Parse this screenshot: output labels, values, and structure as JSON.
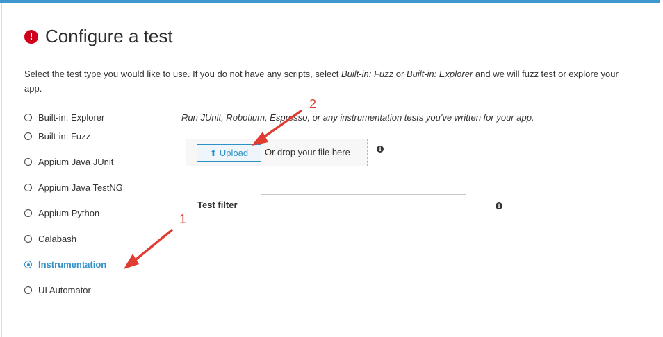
{
  "header": {
    "title": "Configure a test",
    "alert_icon_glyph": "!"
  },
  "description": {
    "prefix": "Select the test type you would like to use. If you do not have any scripts, select ",
    "builtin_fuzz": "Built-in: Fuzz",
    "middle": " or ",
    "builtin_explorer": "Built-in: Explorer",
    "suffix": " and we will fuzz test or explore your app."
  },
  "test_types": [
    {
      "label": "Built-in: Explorer",
      "selected": false
    },
    {
      "label": "Built-in: Fuzz",
      "selected": false
    },
    {
      "label": "Appium Java JUnit",
      "selected": false
    },
    {
      "label": "Appium Java TestNG",
      "selected": false
    },
    {
      "label": "Appium Python",
      "selected": false
    },
    {
      "label": "Calabash",
      "selected": false
    },
    {
      "label": "Instrumentation",
      "selected": true
    },
    {
      "label": "UI Automator",
      "selected": false
    }
  ],
  "instrumentation": {
    "description": "Run JUnit, Robotium, Espresso, or any instrumentation tests you've written for your app.",
    "upload_button": "Upload",
    "upload_icon": "upload-icon",
    "drop_text": "Or drop your file here",
    "test_filter_label": "Test filter",
    "test_filter_value": "",
    "info_glyph": "i"
  },
  "annotations": {
    "label_1": "1",
    "label_2": "2",
    "arrow_color": "#e03c31"
  },
  "colors": {
    "accent": "#3e97cf",
    "selected": "#2f91c8",
    "alert": "#d0021b"
  }
}
